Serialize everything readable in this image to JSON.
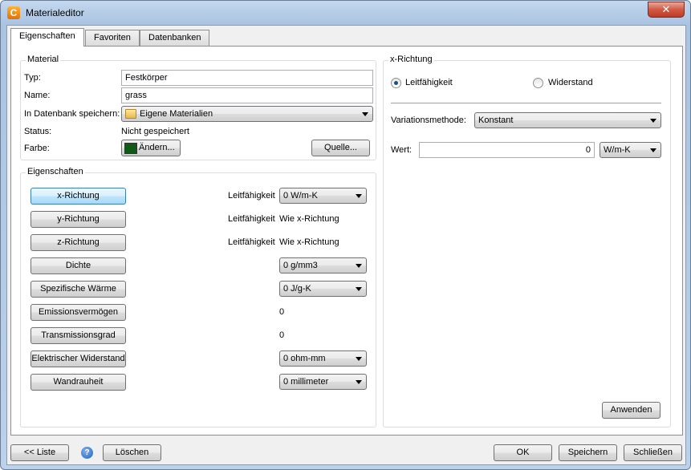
{
  "window": {
    "title": "Materialeditor",
    "close_label": "✕"
  },
  "tabs": [
    {
      "label": "Eigenschaften",
      "active": true
    },
    {
      "label": "Favoriten",
      "active": false
    },
    {
      "label": "Datenbanken",
      "active": false
    }
  ],
  "material": {
    "group_title": "Material",
    "type_label": "Typ:",
    "type_value": "Festkörper",
    "name_label": "Name:",
    "name_value": "grass",
    "db_label": "In Datenbank speichern:",
    "db_value": "Eigene Materialien",
    "status_label": "Status:",
    "status_value": "Nicht gespeichert",
    "color_label": "Farbe:",
    "color_button": "Ändern...",
    "color_value": "#0f5a16",
    "source_button": "Quelle..."
  },
  "properties": {
    "group_title": "Eigenschaften",
    "rows": [
      {
        "button": "x-Richtung",
        "label": "Leitfähigkeit",
        "value": "0 W/m-K",
        "control": "combo",
        "selected": true
      },
      {
        "button": "y-Richtung",
        "label": "Leitfähigkeit",
        "value": "Wie x-Richtung",
        "control": "text"
      },
      {
        "button": "z-Richtung",
        "label": "Leitfähigkeit",
        "value": "Wie x-Richtung",
        "control": "text"
      },
      {
        "button": "Dichte",
        "label": "",
        "value": "0 g/mm3",
        "control": "combo"
      },
      {
        "button": "Spezifische Wärme",
        "label": "",
        "value": "0 J/g-K",
        "control": "combo"
      },
      {
        "button": "Emissionsvermögen",
        "label": "",
        "value": "0",
        "control": "text"
      },
      {
        "button": "Transmissionsgrad",
        "label": "",
        "value": "0",
        "control": "text"
      },
      {
        "button": "Elektrischer Widerstand",
        "label": "",
        "value": "0 ohm-mm",
        "control": "combo"
      },
      {
        "button": "Wandrauheit",
        "label": "",
        "value": "0 millimeter",
        "control": "combo"
      }
    ]
  },
  "xdir": {
    "group_title": "x-Richtung",
    "radio_conductivity": "Leitfähigkeit",
    "radio_resistance": "Widerstand",
    "selected": "Leitfähigkeit",
    "variation_label": "Variationsmethode:",
    "variation_value": "Konstant",
    "value_label": "Wert:",
    "value_value": "0",
    "unit_value": "W/m-K",
    "apply_button": "Anwenden"
  },
  "footer": {
    "list_button": "<< Liste",
    "help_icon": "?",
    "delete_button": "Löschen",
    "ok_button": "OK",
    "save_button": "Speichern",
    "close_button": "Schließen"
  }
}
